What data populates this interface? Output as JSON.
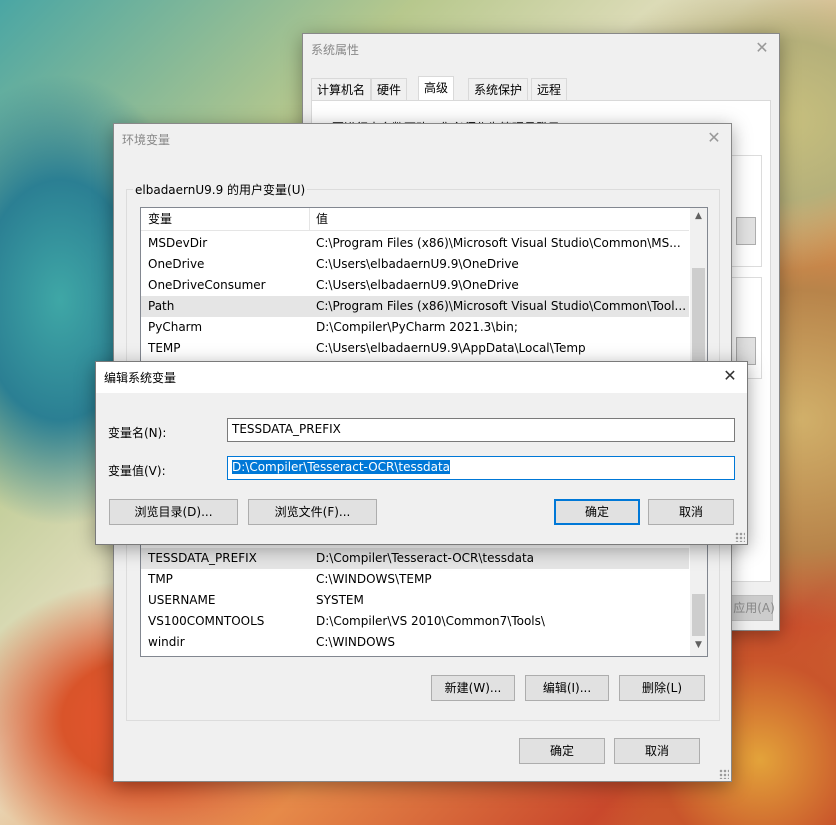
{
  "sysprops": {
    "title": "系统属性",
    "tabs": [
      "计算机名",
      "硬件",
      "高级",
      "系统保护",
      "远程"
    ],
    "active_tab": 2,
    "note": "要进行大多数更改，你必须作为管理员登录",
    "apply_label": "应用(A)"
  },
  "envvars": {
    "title": "环境变量",
    "user_group_label": "elbadaernU9.9 的用户变量(U)",
    "col_var": "变量",
    "col_val": "值",
    "user_rows": [
      {
        "name": "MSDevDir",
        "value": "C:\\Program Files (x86)\\Microsoft Visual Studio\\Common\\MS..."
      },
      {
        "name": "OneDrive",
        "value": "C:\\Users\\elbadaernU9.9\\OneDrive"
      },
      {
        "name": "OneDriveConsumer",
        "value": "C:\\Users\\elbadaernU9.9\\OneDrive"
      },
      {
        "name": "Path",
        "value": "C:\\Program Files (x86)\\Microsoft Visual Studio\\Common\\Tool..."
      },
      {
        "name": "PyCharm",
        "value": "D:\\Compiler\\PyCharm 2021.3\\bin;"
      },
      {
        "name": "TEMP",
        "value": "C:\\Users\\elbadaernU9.9\\AppData\\Local\\Temp"
      }
    ],
    "system_rows": [
      {
        "name": "TESSDATA_PREFIX",
        "value": "D:\\Compiler\\Tesseract-OCR\\tessdata"
      },
      {
        "name": "TMP",
        "value": "C:\\WINDOWS\\TEMP"
      },
      {
        "name": "USERNAME",
        "value": "SYSTEM"
      },
      {
        "name": "VS100COMNTOOLS",
        "value": "D:\\Compiler\\VS 2010\\Common7\\Tools\\"
      },
      {
        "name": "windir",
        "value": "C:\\WINDOWS"
      }
    ],
    "new_label": "新建(W)...",
    "edit_label": "编辑(I)...",
    "delete_label": "删除(L)",
    "ok_label": "确定",
    "cancel_label": "取消"
  },
  "editdlg": {
    "title": "编辑系统变量",
    "name_label": "变量名(N):",
    "name_value": "TESSDATA_PREFIX",
    "value_label": "变量值(V):",
    "value_value": "D:\\Compiler\\Tesseract-OCR\\tessdata",
    "browse_dir_label": "浏览目录(D)...",
    "browse_file_label": "浏览文件(F)...",
    "ok_label": "确定",
    "cancel_label": "取消"
  },
  "icons": {
    "close": "close-icon",
    "scroll_up": "scroll-up-icon",
    "scroll_down": "scroll-down-icon"
  }
}
